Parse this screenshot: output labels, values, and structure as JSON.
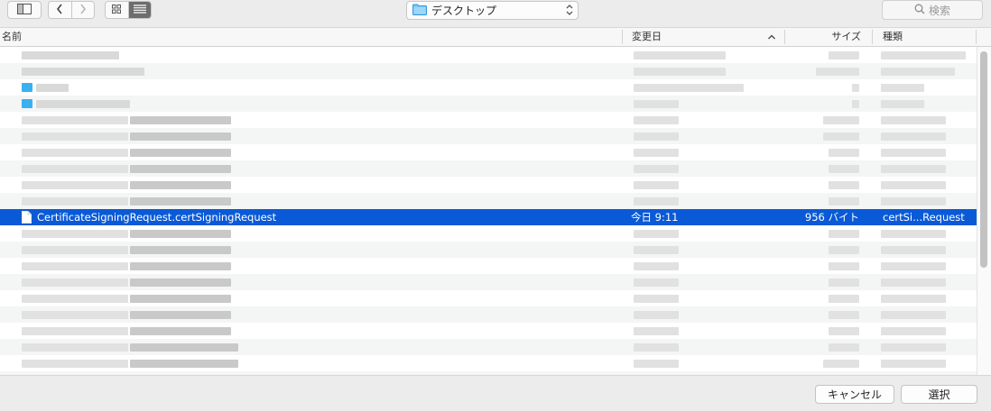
{
  "toolbar": {
    "location": "デスクトップ",
    "search_placeholder": "検索"
  },
  "columns": {
    "name": "名前",
    "date": "変更日",
    "size": "サイズ",
    "kind": "種類"
  },
  "selected_file": {
    "name": "CertificateSigningRequest.certSigningRequest",
    "date": "今日 9:11",
    "size": "956 バイト",
    "kind": "certSi...Request"
  },
  "buttons": {
    "cancel": "キャンセル",
    "select": "選択"
  },
  "colors": {
    "selection": "#0a5ad7",
    "folder": "#3ab0f0"
  },
  "icons": [
    "sidebar-toggle-icon",
    "back-icon",
    "forward-icon",
    "icon-view-icon",
    "list-view-icon",
    "folder-icon",
    "updown-icon",
    "search-icon",
    "sort-up-icon",
    "document-icon"
  ]
}
